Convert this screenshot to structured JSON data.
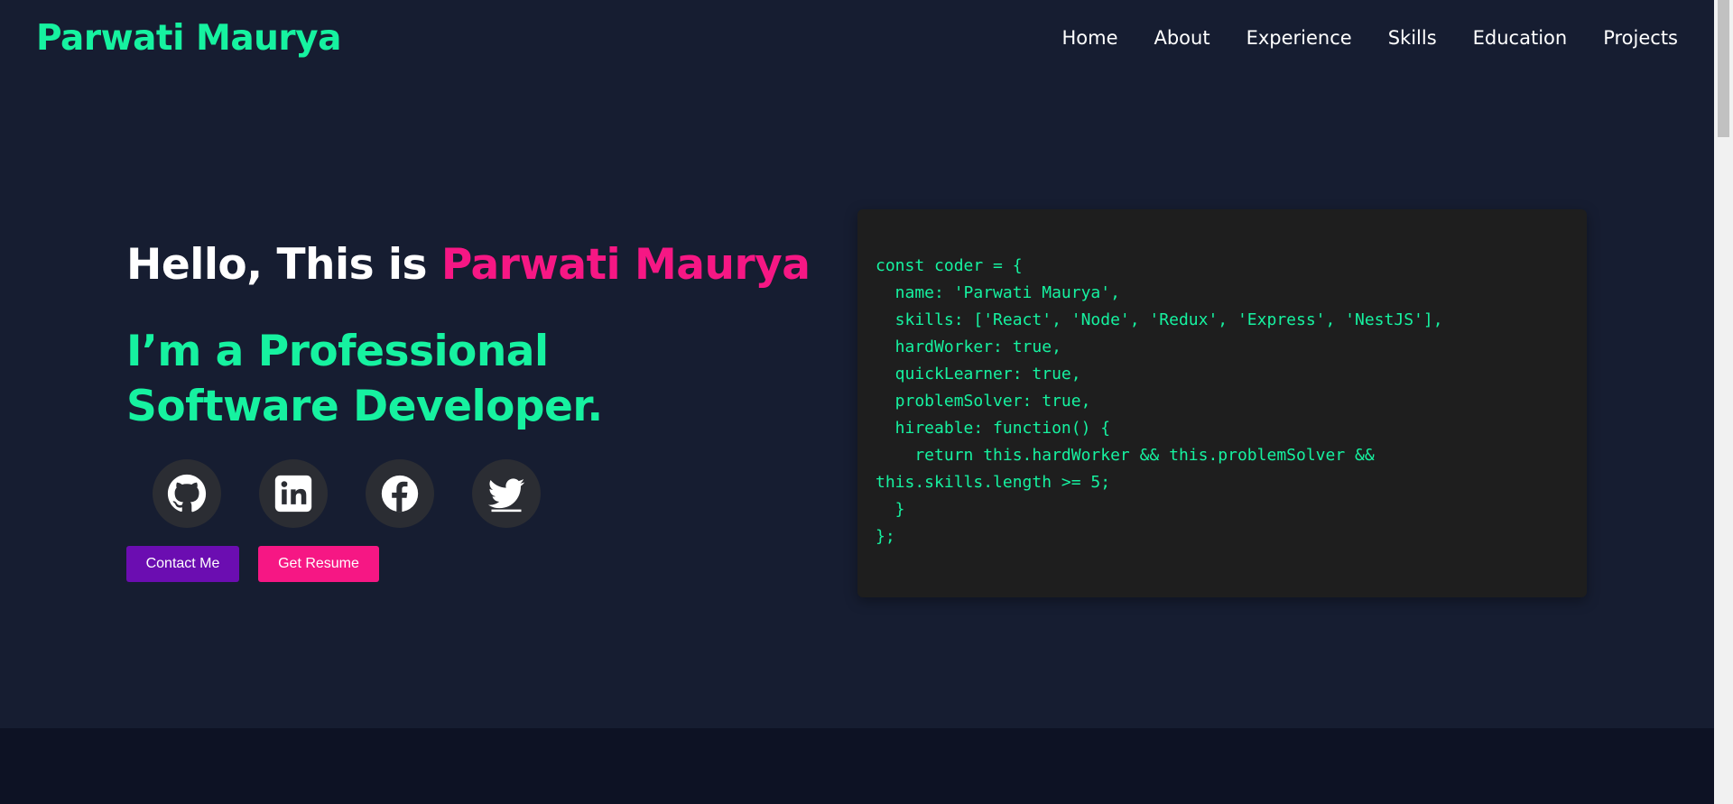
{
  "nav": {
    "brand": "Parwati Maurya",
    "links": [
      {
        "label": "Home"
      },
      {
        "label": "About"
      },
      {
        "label": "Experience"
      },
      {
        "label": "Skills"
      },
      {
        "label": "Education"
      },
      {
        "label": "Projects"
      }
    ]
  },
  "hero": {
    "greeting_prefix": "Hello, This is ",
    "greeting_name": "Parwati Maurya",
    "role": "I’m a Professional Software Developer.",
    "socials": [
      {
        "icon": "github-icon"
      },
      {
        "icon": "linkedin-icon"
      },
      {
        "icon": "facebook-icon"
      },
      {
        "icon": "twitter-icon"
      }
    ],
    "contact_label": "Contact Me",
    "resume_label": "Get Resume"
  },
  "code": {
    "lines": [
      "const coder = {",
      "  name: 'Parwati Maurya',",
      "  skills: ['React', 'Node', 'Redux', 'Express', 'NestJS'],",
      "  hardWorker: true,",
      "  quickLearner: true,",
      "  problemSolver: true,",
      "  hireable: function() {",
      "    return this.hardWorker && this.problemSolver &&",
      "this.skills.length >= 5;",
      "  }",
      "};"
    ]
  },
  "colors": {
    "background": "#161d31",
    "accent_green": "#16f2a0",
    "accent_pink": "#f61784",
    "contact_button": "#6b0db1",
    "code_background": "#1e1e1e"
  }
}
